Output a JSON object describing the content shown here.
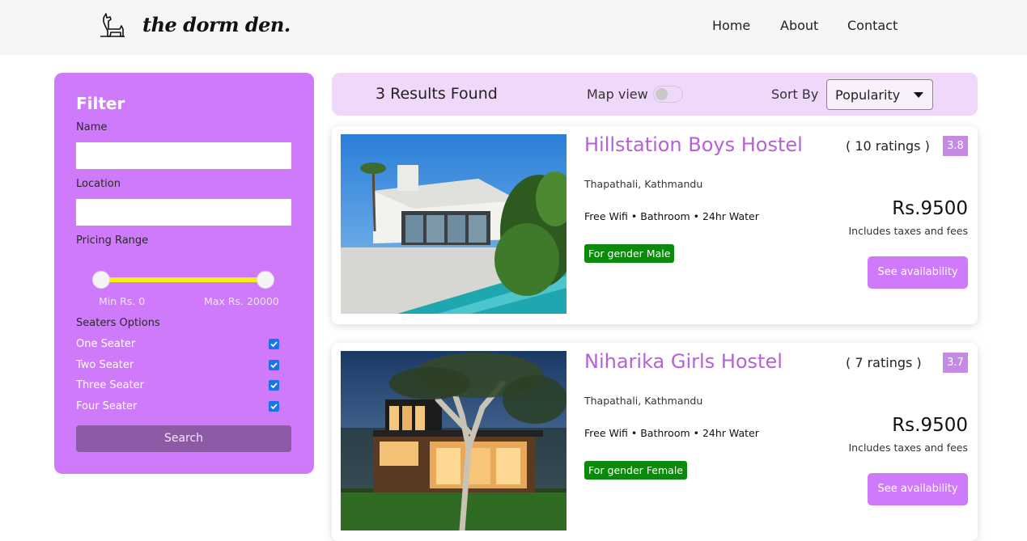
{
  "header": {
    "logo_text": "the dorm den.",
    "logo_icon": "goat-icon",
    "nav": {
      "home": "Home",
      "about": "About",
      "contact": "Contact"
    }
  },
  "filter": {
    "title": "Filter",
    "name_label": "Name",
    "name_value": "",
    "location_label": "Location",
    "location_value": "",
    "pricing_label": "Pricing Range",
    "min_label": "Min Rs. 0",
    "max_label": "Max Rs. 20000",
    "seaters_label": "Seaters Options",
    "seaters": [
      {
        "label": "One Seater",
        "checked": true
      },
      {
        "label": "Two Seater",
        "checked": true
      },
      {
        "label": "Three Seater",
        "checked": true
      },
      {
        "label": "Four Seater",
        "checked": true
      }
    ],
    "search_label": "Search"
  },
  "results_bar": {
    "count_text": "3 Results Found",
    "map_view_label": "Map view",
    "map_view_on": false,
    "sort_label": "Sort By",
    "sort_value": "Popularity"
  },
  "listings": [
    {
      "name": "Hillstation Boys Hostel",
      "ratings": "( 10 ratings )",
      "score": "3.8",
      "location": "Thapathali, Kathmandu",
      "amenities": "Free Wifi • Bathroom • 24hr Water",
      "gender": "For gender Male",
      "price": "Rs.9500",
      "price_note": "Includes taxes and fees",
      "cta": "See availability"
    },
    {
      "name": "Niharika Girls Hostel",
      "ratings": "( 7 ratings )",
      "score": "3.7",
      "location": "Thapathali, Kathmandu",
      "amenities": "Free Wifi • Bathroom • 24hr Water",
      "gender": "For gender Female",
      "price": "Rs.9500",
      "price_note": "Includes taxes and fees",
      "cta": "See availability"
    }
  ],
  "colors": {
    "accent": "#cf79fb",
    "accent_light": "#efd8fa",
    "title_purple": "#b561d8",
    "score_bg": "#c58ae3",
    "gender_green": "#0c8a0c",
    "slider_yellow": "#f6ee13"
  }
}
